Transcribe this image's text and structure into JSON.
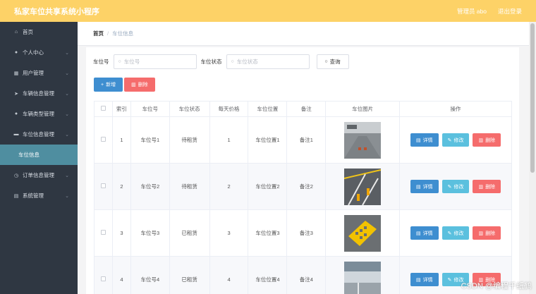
{
  "app": {
    "title": "私家车位共享系统小程序"
  },
  "header": {
    "user_label": "管理员 abo",
    "logout_label": "退出登录"
  },
  "sidebar": {
    "items": [
      {
        "label": "首页",
        "icon": "home-icon",
        "glyph": "⌂",
        "chevron": false
      },
      {
        "label": "个人中心",
        "icon": "user-icon",
        "glyph": "●",
        "chevron": true
      },
      {
        "label": "用户管理",
        "icon": "grid-icon",
        "glyph": "▦",
        "chevron": true
      },
      {
        "label": "车辆信息管理",
        "icon": "send-icon",
        "glyph": "➤",
        "chevron": true
      },
      {
        "label": "车辆类型管理",
        "icon": "user-icon",
        "glyph": "●",
        "chevron": true
      },
      {
        "label": "车位信息管理",
        "icon": "car-icon",
        "glyph": "▬",
        "chevron": true
      },
      {
        "label": "车位信息",
        "icon": "",
        "glyph": "",
        "chevron": false,
        "active": true
      },
      {
        "label": "订单信息管理",
        "icon": "clock-icon",
        "glyph": "◷",
        "chevron": true
      },
      {
        "label": "系统管理",
        "icon": "doc-icon",
        "glyph": "▤",
        "chevron": true
      }
    ]
  },
  "breadcrumb": {
    "home": "首页",
    "separator": "/",
    "current": "车位信息"
  },
  "filters": {
    "spot_no_label": "车位号",
    "spot_no_placeholder": "车位号",
    "status_label": "车位状态",
    "status_placeholder": "车位状态",
    "search_label": "查询"
  },
  "toolbar": {
    "add_label": "新增",
    "delete_label": "删除"
  },
  "table": {
    "headers": [
      "索引",
      "车位号",
      "车位状态",
      "每天价格",
      "车位位置",
      "备注",
      "车位图片",
      "操作"
    ],
    "rows": [
      {
        "index": "1",
        "spot_no": "车位号1",
        "status": "待租赁",
        "price": "1",
        "location": "车位位置1",
        "remark": "备注1"
      },
      {
        "index": "2",
        "spot_no": "车位号2",
        "status": "待租赁",
        "price": "2",
        "location": "车位位置2",
        "remark": "备注2"
      },
      {
        "index": "3",
        "spot_no": "车位号3",
        "status": "已租赁",
        "price": "3",
        "location": "车位位置3",
        "remark": "备注3"
      },
      {
        "index": "4",
        "spot_no": "车位号4",
        "status": "已租赁",
        "price": "4",
        "location": "车位位置4",
        "remark": "备注4"
      }
    ],
    "row_actions": {
      "detail": "详情",
      "edit": "修改",
      "delete": "删除"
    }
  },
  "watermark": "CSDN @编程千纸鹤",
  "colors": {
    "topbar": "#fdd267",
    "sidebar": "#2f3742",
    "active": "#4f8ea0",
    "primary": "#3e8ed0",
    "danger": "#f56c6c",
    "info": "#5bc0de"
  }
}
